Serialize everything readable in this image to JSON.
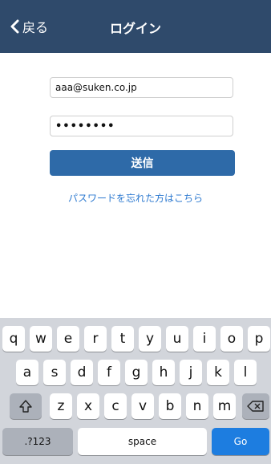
{
  "nav": {
    "back_label": "戻る",
    "title": "ログイン"
  },
  "form": {
    "email_value": "aaa@suken.co.jp",
    "password_value": "••••••••",
    "submit_label": "送信",
    "forgot_link": "パスワードを忘れた方はこちら"
  },
  "keyboard": {
    "row1": [
      "q",
      "w",
      "e",
      "r",
      "t",
      "y",
      "u",
      "i",
      "o",
      "p"
    ],
    "row2": [
      "a",
      "s",
      "d",
      "f",
      "g",
      "h",
      "j",
      "k",
      "l"
    ],
    "row3": [
      "z",
      "x",
      "c",
      "v",
      "b",
      "n",
      "m"
    ],
    "numbers_label": ".?123",
    "space_label": "space",
    "go_label": "Go"
  },
  "colors": {
    "nav_bg": "#2f4a6b",
    "button_bg": "#2e6aa8",
    "link": "#2e7ad0",
    "go_key": "#1d7de0"
  }
}
